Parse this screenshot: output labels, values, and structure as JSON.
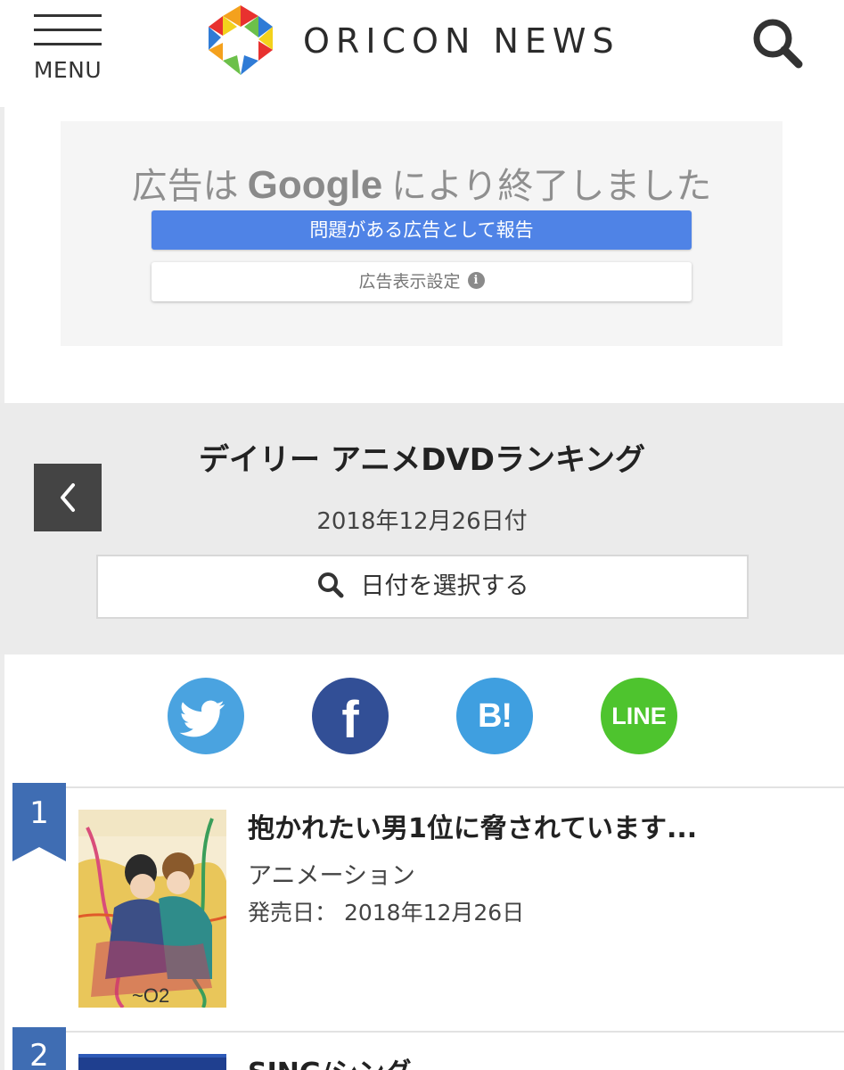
{
  "header": {
    "menu_label": "MENU",
    "logo_text": "ORICON NEWS"
  },
  "ad": {
    "message_before": "広告は",
    "message_brand": "Google",
    "message_after": "により終了しました",
    "report_button": "問題がある広告として報告",
    "settings_button": "広告表示設定"
  },
  "ranking": {
    "title": "デイリー アニメDVDランキング",
    "date": "2018年12月26日付",
    "select_date_button": "日付を選択する"
  },
  "social": {
    "facebook": "f",
    "hatena": "B!",
    "line": "LINE"
  },
  "items": [
    {
      "rank": "1",
      "title": "抱かれたい男1位に脅されています...",
      "genre": "アニメーション",
      "release_label": "発売日：",
      "release_date": "2018年12月26日"
    },
    {
      "rank": "2",
      "title": "SING/シング"
    }
  ],
  "colors": {
    "rank_badge": "#3f6db3",
    "ad_report": "#4f83e6",
    "twitter": "#4aa3e0",
    "facebook": "#324f96",
    "hatena": "#3f9fe0",
    "line": "#4ec42e"
  }
}
